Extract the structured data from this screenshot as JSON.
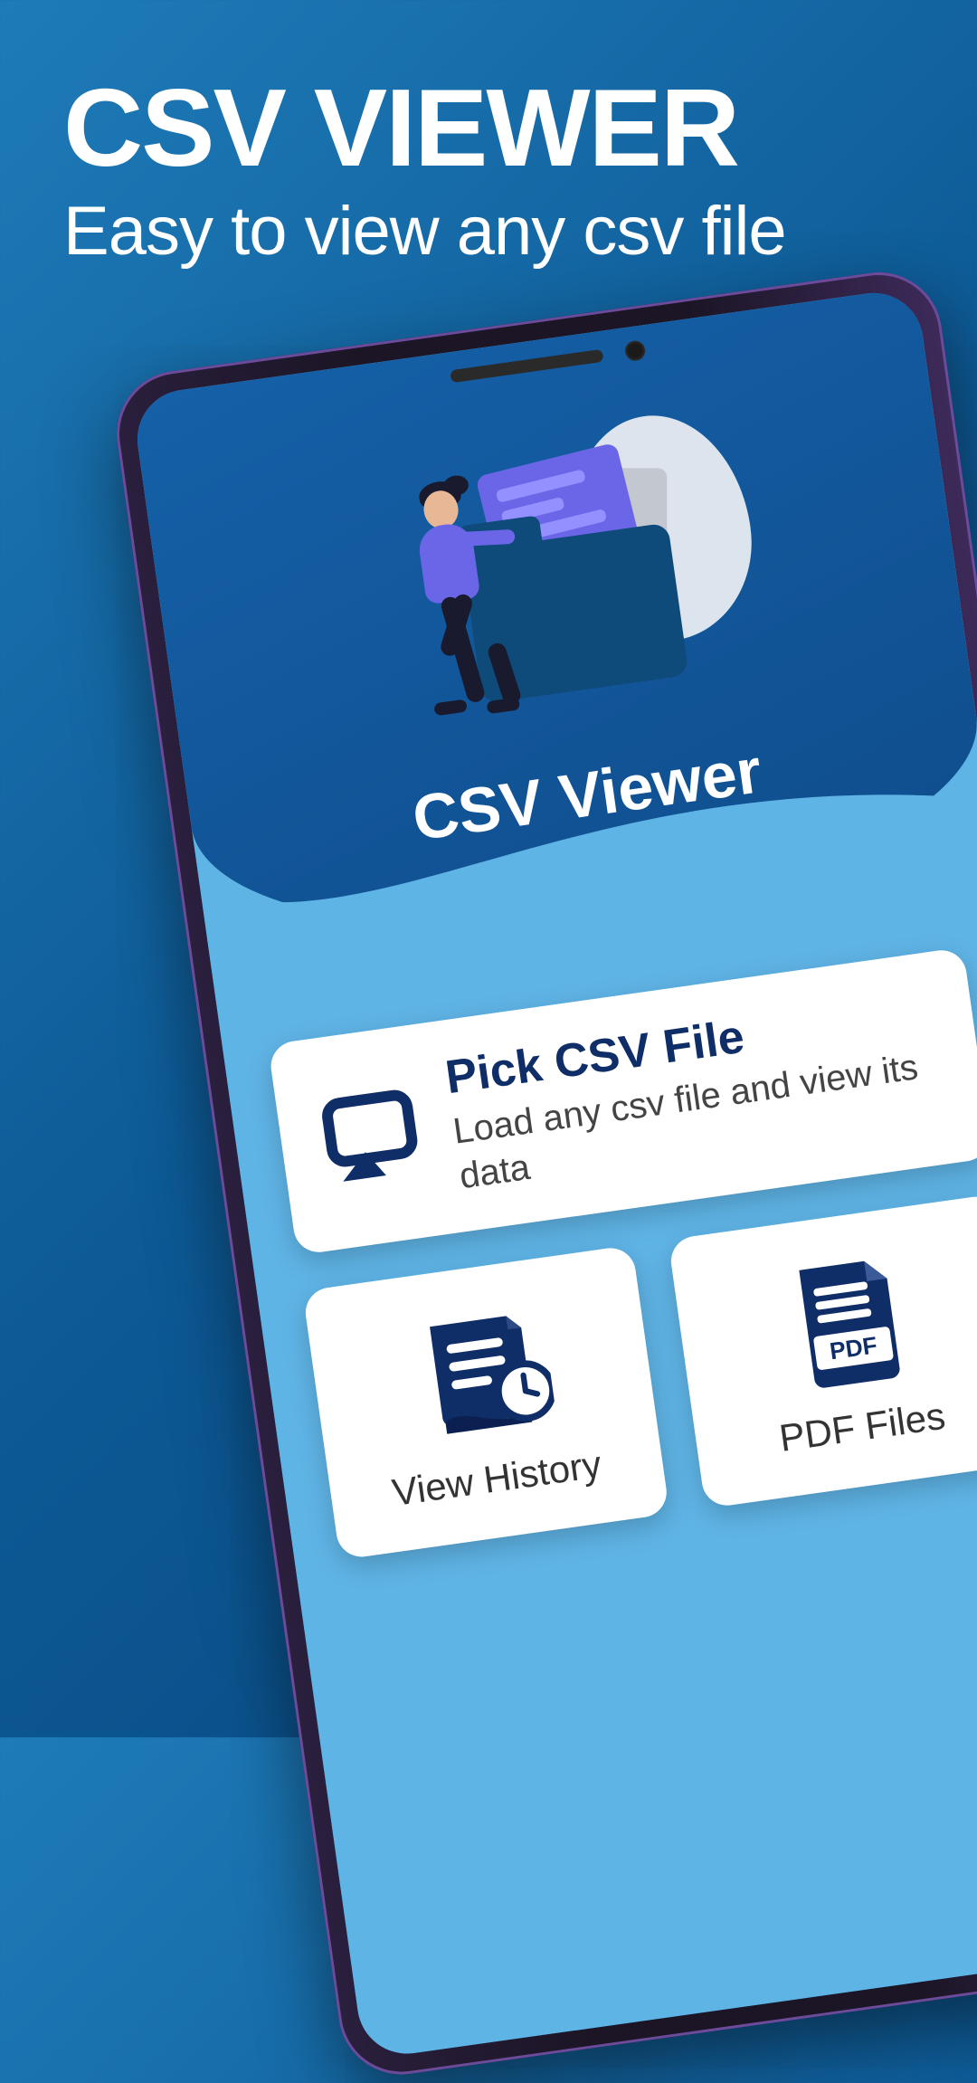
{
  "promo": {
    "title": "CSV VIEWER",
    "subtitle": "Easy to view any csv file"
  },
  "app": {
    "title": "CSV Viewer"
  },
  "cards": {
    "pick": {
      "title": "Pick CSV File",
      "desc": "Load any csv file and view its data"
    },
    "history": {
      "label": "View History"
    },
    "pdf": {
      "badge": "PDF",
      "label": "PDF Files"
    }
  },
  "colors": {
    "bg_gradient_start": "#1e7bb8",
    "bg_gradient_end": "#084880",
    "header_blue": "#0f4d8c",
    "light_blue": "#5fb4e6",
    "dark_navy": "#0f2d66",
    "accent_purple": "#6b66e8"
  }
}
